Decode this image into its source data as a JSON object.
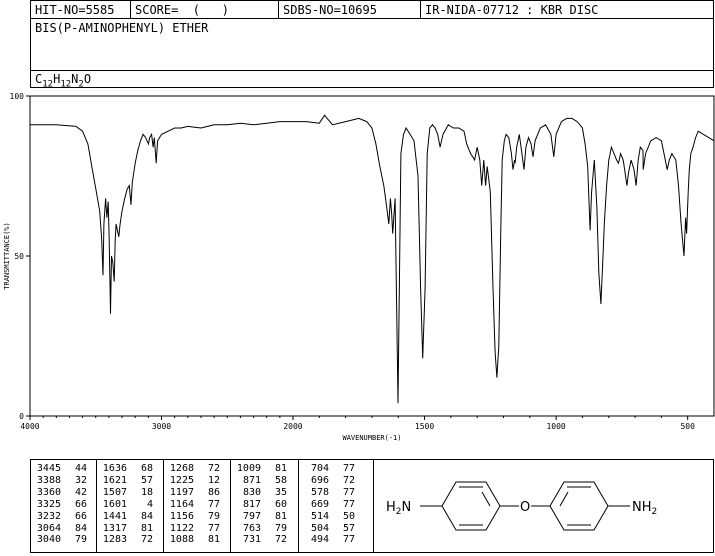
{
  "header": {
    "hit_no": "HIT-NO=5585",
    "score": "SCORE=  (   )",
    "sdbs_no": "SDBS-NO=10695",
    "ir_info": "IR-NIDA-07712 : KBR DISC"
  },
  "compound": {
    "name": "BIS(P-AMINOPHENYL) ETHER",
    "formula_parts": [
      {
        "text": "C",
        "sub": false
      },
      {
        "text": "12",
        "sub": true
      },
      {
        "text": "H",
        "sub": false
      },
      {
        "text": "12",
        "sub": true
      },
      {
        "text": "N",
        "sub": false
      },
      {
        "text": "2",
        "sub": true
      },
      {
        "text": "O",
        "sub": false
      }
    ]
  },
  "chart_data": {
    "type": "line",
    "xlabel": "WAVENUMBER(-1)",
    "ylabel": "TRANSMITTANCE(%)",
    "xlim": [
      4000,
      400
    ],
    "ylim": [
      0,
      100
    ],
    "x_ticks": [
      4000,
      3000,
      2000,
      1500,
      1000,
      500
    ],
    "y_ticks": [
      0,
      50,
      100
    ],
    "series": [
      {
        "points": [
          [
            4000,
            91
          ],
          [
            3800,
            91
          ],
          [
            3650,
            90.5
          ],
          [
            3600,
            89
          ],
          [
            3560,
            85
          ],
          [
            3530,
            78
          ],
          [
            3500,
            71
          ],
          [
            3470,
            64
          ],
          [
            3455,
            55
          ],
          [
            3445,
            44
          ],
          [
            3438,
            60
          ],
          [
            3425,
            68
          ],
          [
            3415,
            62
          ],
          [
            3405,
            67
          ],
          [
            3398,
            55
          ],
          [
            3388,
            32
          ],
          [
            3380,
            50
          ],
          [
            3370,
            48
          ],
          [
            3360,
            42
          ],
          [
            3352,
            55
          ],
          [
            3345,
            60
          ],
          [
            3335,
            58
          ],
          [
            3325,
            56
          ],
          [
            3315,
            60
          ],
          [
            3300,
            64
          ],
          [
            3280,
            68
          ],
          [
            3260,
            71
          ],
          [
            3245,
            72
          ],
          [
            3232,
            66
          ],
          [
            3222,
            73
          ],
          [
            3200,
            79
          ],
          [
            3180,
            83
          ],
          [
            3160,
            86
          ],
          [
            3140,
            88
          ],
          [
            3120,
            87
          ],
          [
            3100,
            85
          ],
          [
            3090,
            87
          ],
          [
            3075,
            88
          ],
          [
            3064,
            84
          ],
          [
            3055,
            87
          ],
          [
            3040,
            79
          ],
          [
            3030,
            86
          ],
          [
            3000,
            88
          ],
          [
            2950,
            89
          ],
          [
            2900,
            90
          ],
          [
            2850,
            90
          ],
          [
            2800,
            90.5
          ],
          [
            2700,
            90
          ],
          [
            2600,
            91
          ],
          [
            2500,
            91
          ],
          [
            2400,
            91.5
          ],
          [
            2300,
            91
          ],
          [
            2200,
            91.5
          ],
          [
            2100,
            92
          ],
          [
            2000,
            92
          ],
          [
            1950,
            92
          ],
          [
            1900,
            91.5
          ],
          [
            1880,
            94
          ],
          [
            1870,
            93
          ],
          [
            1850,
            91
          ],
          [
            1800,
            92
          ],
          [
            1750,
            93
          ],
          [
            1720,
            92
          ],
          [
            1700,
            90
          ],
          [
            1685,
            85
          ],
          [
            1670,
            78
          ],
          [
            1655,
            72
          ],
          [
            1645,
            66
          ],
          [
            1636,
            60
          ],
          [
            1630,
            68
          ],
          [
            1625,
            63
          ],
          [
            1621,
            57
          ],
          [
            1612,
            68
          ],
          [
            1601,
            4
          ],
          [
            1590,
            82
          ],
          [
            1580,
            88
          ],
          [
            1570,
            90
          ],
          [
            1555,
            88
          ],
          [
            1540,
            86
          ],
          [
            1525,
            75
          ],
          [
            1515,
            40
          ],
          [
            1507,
            18
          ],
          [
            1498,
            40
          ],
          [
            1490,
            82
          ],
          [
            1480,
            90
          ],
          [
            1470,
            91
          ],
          [
            1460,
            90
          ],
          [
            1450,
            88
          ],
          [
            1441,
            84
          ],
          [
            1430,
            88
          ],
          [
            1410,
            91
          ],
          [
            1390,
            90
          ],
          [
            1370,
            90
          ],
          [
            1350,
            89
          ],
          [
            1340,
            85
          ],
          [
            1330,
            83
          ],
          [
            1325,
            82
          ],
          [
            1317,
            81
          ],
          [
            1310,
            80
          ],
          [
            1300,
            84
          ],
          [
            1290,
            80
          ],
          [
            1283,
            72
          ],
          [
            1275,
            80
          ],
          [
            1268,
            72
          ],
          [
            1262,
            78
          ],
          [
            1250,
            70
          ],
          [
            1240,
            40
          ],
          [
            1232,
            20
          ],
          [
            1225,
            12
          ],
          [
            1218,
            22
          ],
          [
            1210,
            60
          ],
          [
            1205,
            80
          ],
          [
            1197,
            86
          ],
          [
            1190,
            88
          ],
          [
            1180,
            87
          ],
          [
            1170,
            82
          ],
          [
            1164,
            77
          ],
          [
            1158,
            80
          ],
          [
            1156,
            79
          ],
          [
            1150,
            84
          ],
          [
            1140,
            88
          ],
          [
            1130,
            82
          ],
          [
            1122,
            77
          ],
          [
            1115,
            84
          ],
          [
            1105,
            87
          ],
          [
            1095,
            85
          ],
          [
            1088,
            81
          ],
          [
            1080,
            86
          ],
          [
            1060,
            90
          ],
          [
            1040,
            91
          ],
          [
            1020,
            88
          ],
          [
            1009,
            81
          ],
          [
            1000,
            88
          ],
          [
            980,
            92
          ],
          [
            960,
            93
          ],
          [
            940,
            93
          ],
          [
            920,
            92
          ],
          [
            900,
            90
          ],
          [
            890,
            85
          ],
          [
            880,
            78
          ],
          [
            871,
            58
          ],
          [
            865,
            70
          ],
          [
            855,
            80
          ],
          [
            845,
            65
          ],
          [
            838,
            45
          ],
          [
            830,
            35
          ],
          [
            822,
            50
          ],
          [
            817,
            60
          ],
          [
            808,
            72
          ],
          [
            800,
            80
          ],
          [
            797,
            81
          ],
          [
            790,
            84
          ],
          [
            780,
            82
          ],
          [
            770,
            80
          ],
          [
            763,
            79
          ],
          [
            755,
            82
          ],
          [
            745,
            80
          ],
          [
            738,
            76
          ],
          [
            731,
            72
          ],
          [
            725,
            76
          ],
          [
            715,
            80
          ],
          [
            704,
            77
          ],
          [
            696,
            72
          ],
          [
            688,
            80
          ],
          [
            680,
            84
          ],
          [
            670,
            83
          ],
          [
            669,
            77
          ],
          [
            660,
            82
          ],
          [
            640,
            86
          ],
          [
            620,
            87
          ],
          [
            600,
            86
          ],
          [
            590,
            82
          ],
          [
            578,
            77
          ],
          [
            570,
            80
          ],
          [
            560,
            82
          ],
          [
            545,
            80
          ],
          [
            535,
            72
          ],
          [
            525,
            60
          ],
          [
            514,
            50
          ],
          [
            508,
            62
          ],
          [
            504,
            57
          ],
          [
            498,
            70
          ],
          [
            494,
            77
          ],
          [
            488,
            82
          ],
          [
            480,
            84
          ],
          [
            470,
            87
          ],
          [
            460,
            89
          ],
          [
            440,
            88
          ],
          [
            420,
            87
          ],
          [
            400,
            86
          ]
        ]
      }
    ]
  },
  "peaks": [
    [
      [
        "3445",
        "44"
      ],
      [
        "3388",
        "32"
      ],
      [
        "3360",
        "42"
      ],
      [
        "3325",
        "66"
      ],
      [
        "3232",
        "66"
      ],
      [
        "3064",
        "84"
      ],
      [
        "3040",
        "79"
      ]
    ],
    [
      [
        "1636",
        "68"
      ],
      [
        "1621",
        "57"
      ],
      [
        "1507",
        "18"
      ],
      [
        "1601",
        "4"
      ],
      [
        "1441",
        "84"
      ],
      [
        "1317",
        "81"
      ],
      [
        "1283",
        "72"
      ]
    ],
    [
      [
        "1268",
        "72"
      ],
      [
        "1225",
        "12"
      ],
      [
        "1197",
        "86"
      ],
      [
        "1164",
        "77"
      ],
      [
        "1156",
        "79"
      ],
      [
        "1122",
        "77"
      ],
      [
        "1088",
        "81"
      ]
    ],
    [
      [
        "1009",
        "81"
      ],
      [
        "871",
        "58"
      ],
      [
        "830",
        "35"
      ],
      [
        "817",
        "60"
      ],
      [
        "797",
        "81"
      ],
      [
        "763",
        "79"
      ],
      [
        "731",
        "72"
      ]
    ],
    [
      [
        "704",
        "77"
      ],
      [
        "696",
        "72"
      ],
      [
        "578",
        "77"
      ],
      [
        "669",
        "77"
      ],
      [
        "514",
        "50"
      ],
      [
        "504",
        "57"
      ],
      [
        "494",
        "77"
      ]
    ]
  ],
  "structure": {
    "left_group": "H2N",
    "bridge_atom": "O",
    "right_group": "NH2"
  }
}
